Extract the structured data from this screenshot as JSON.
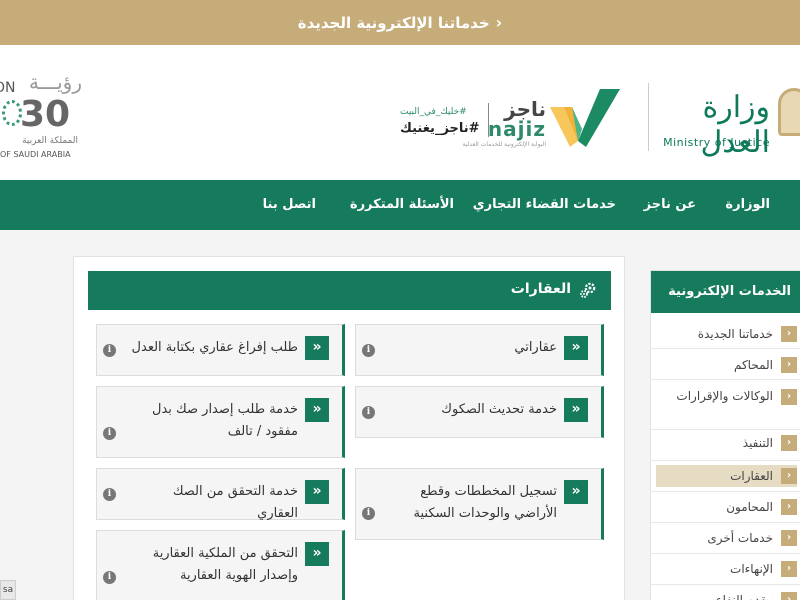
{
  "topbar": {
    "text": "خدماتنا الإلكترونية الجديدة",
    "chevron": "‹"
  },
  "moj": {
    "name_ar": "وزارة العدل",
    "name_en": "Ministry of Justice"
  },
  "najiz": {
    "name_ar": "ناجز",
    "name_en": "najiz",
    "subtitle": "البوابة الإلكترونية للخدمات العدلية",
    "tagline_small": "#خليك_في_البيت",
    "tagline": "#ناجز_يغنيك"
  },
  "vision": {
    "word_ar": "رؤيـــة",
    "on": "ON",
    "year": "30",
    "country_ar": "المملكة العربية",
    "country_en": "OF SAUDI ARABIA"
  },
  "nav": [
    {
      "label": "الوزارة"
    },
    {
      "label": "عن ناجز"
    },
    {
      "label": "خدمات القضاء التجاري"
    },
    {
      "label": "الأسئلة المتكررة"
    },
    {
      "label": "اتصل بنا"
    }
  ],
  "panel": {
    "title": "العقارات",
    "cards": [
      {
        "label": "عقاراتي"
      },
      {
        "label": "طلب إفراغ عقاري بكتابة العدل"
      },
      {
        "label": "خدمة تحديث الصكوك"
      },
      {
        "label": "خدمة طلب إصدار صك بدل مفقود / تالف"
      },
      {
        "label": "خدمة التحقق من الصك العقاري"
      },
      {
        "label": "تسجيل المخططات وقطع الأراضي والوحدات السكنية"
      },
      {
        "label": "التحقق من الملكية العقارية وإصدار الهوية العقارية"
      }
    ]
  },
  "sidebar": {
    "title": "الخدمات الإلكترونية",
    "items": [
      {
        "label": "خدماتنا الجديدة"
      },
      {
        "label": "المحاكم"
      },
      {
        "label": "الوكالات والإقرارات"
      },
      {
        "label": "التنفيذ"
      },
      {
        "label": "العقارات"
      },
      {
        "label": "المحامون"
      },
      {
        "label": "خدمات أخرى"
      },
      {
        "label": "الإنهاءات"
      },
      {
        "label": "مقدم النفاع"
      }
    ]
  },
  "badge": {
    "text": "sa"
  },
  "colors": {
    "primary": "#167a5d",
    "gold": "#c5ac79"
  }
}
